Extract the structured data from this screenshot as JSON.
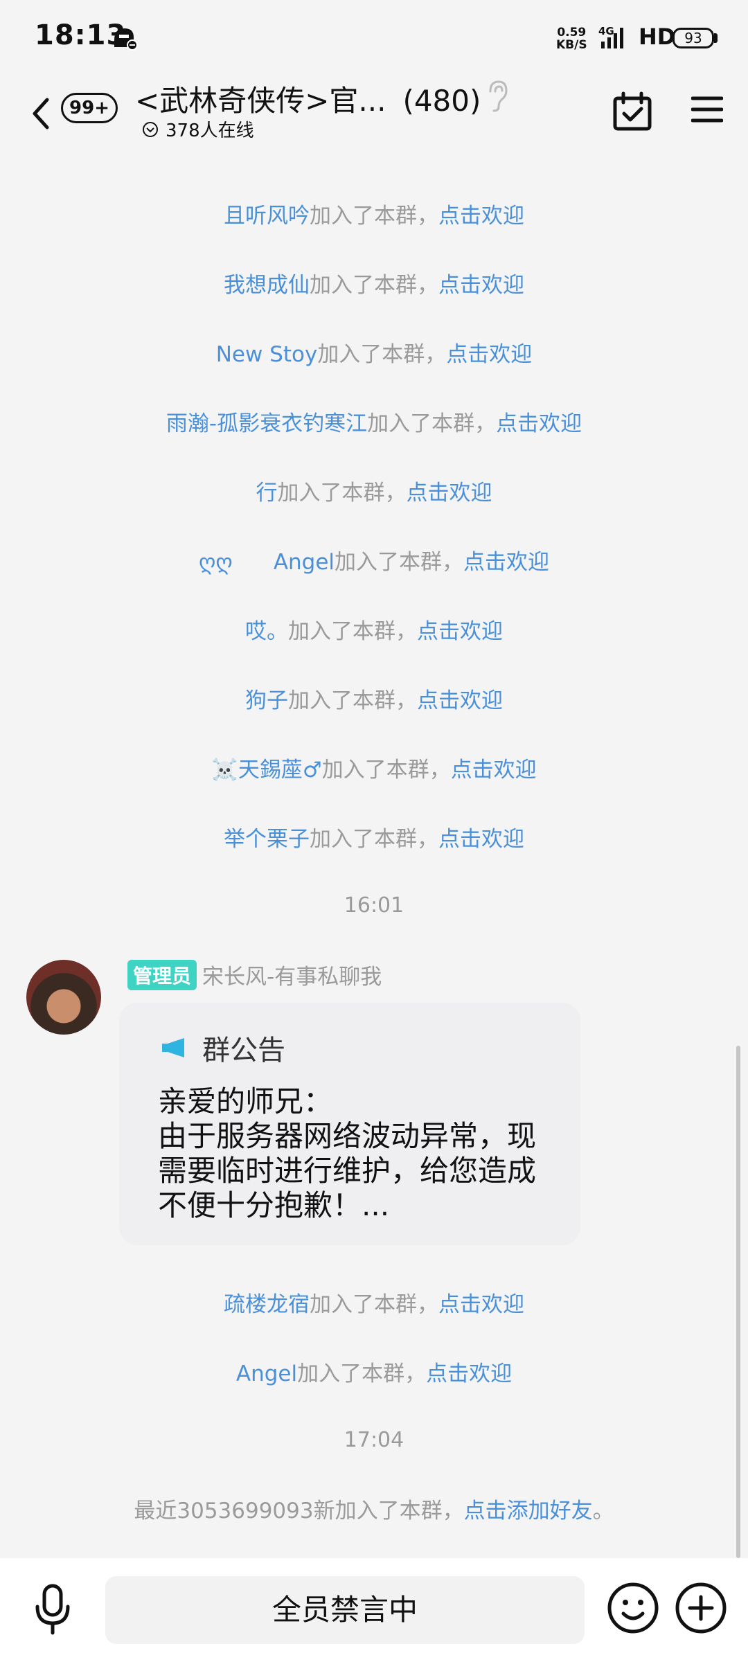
{
  "status_bar": {
    "time": "18:13",
    "net_speed_value": "0.59",
    "net_speed_unit": "KB/S",
    "network": "4G",
    "hd": "HD",
    "battery": "93"
  },
  "header": {
    "back_badge": "99+",
    "title": "<武林奇侠传>官...",
    "member_count": "(480)",
    "online_text": "378人在线"
  },
  "messages": {
    "joins_top": [
      {
        "name": "且听风吟",
        "text": "加入了本群，",
        "action": "点击欢迎"
      },
      {
        "name": "我想成仙",
        "text": "加入了本群，",
        "action": "点击欢迎"
      },
      {
        "name": "New Stoy",
        "text": "加入了本群，",
        "action": "点击欢迎"
      },
      {
        "name": "雨瀚-孤影衰衣钓寒江",
        "text": "加入了本群，",
        "action": "点击欢迎"
      },
      {
        "name": "行",
        "text": "加入了本群，",
        "action": "点击欢迎"
      },
      {
        "name": "ღღ      Angel",
        "text": "加入了本群，",
        "action": "点击欢迎"
      },
      {
        "name": "哎。",
        "text": "加入了本群，",
        "action": "点击欢迎"
      },
      {
        "name": "狗子",
        "text": "加入了本群，",
        "action": "点击欢迎"
      },
      {
        "name": "☠️天錫蓙♂",
        "text": "加入了本群，",
        "action": "点击欢迎"
      },
      {
        "name": "举个栗子",
        "text": "加入了本群，",
        "action": "点击欢迎"
      }
    ],
    "time_1": "16:01",
    "announcement": {
      "role": "管理员",
      "sender": "宋长风-有事私聊我",
      "title": "群公告",
      "body": "亲爱的师兄：\n由于服务器网络波动异常，现需要临时进行维护，给您造成不便十分抱歉！..."
    },
    "joins_bottom": [
      {
        "name": "疏楼龙宿",
        "text": "加入了本群，",
        "action": "点击欢迎"
      },
      {
        "name": "Angel",
        "text": "加入了本群，",
        "action": "点击欢迎"
      }
    ],
    "time_2": "17:04",
    "recent_join": {
      "text": "最近3053699093新加入了本群，",
      "action": "点击添加好友",
      "end": "。"
    }
  },
  "bottom_bar": {
    "input_text": "全员禁言中"
  },
  "icons": [
    "back-icon",
    "ear-icon",
    "chevron-down-circle-icon",
    "calendar-check-icon",
    "menu-icon",
    "megaphone-icon",
    "mic-icon",
    "emoji-icon",
    "plus-icon"
  ],
  "colors": {
    "link": "#4a90d9",
    "admin_tag": "#3fd3c4",
    "system_text": "#9a9a9a"
  }
}
